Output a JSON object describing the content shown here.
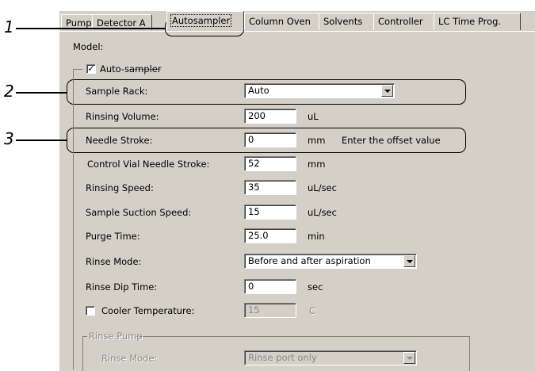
{
  "tabs": [
    "Pump",
    "Detector A",
    "Autosampler",
    "Column Oven",
    "Solvents",
    "Controller",
    "LC Time Prog."
  ],
  "active_tab": "Autosampler",
  "model_label": "Model:",
  "autosampler_checkbox": {
    "label": "Auto-sampler",
    "checked": "✓"
  },
  "callouts": [
    "1",
    "2",
    "3"
  ],
  "sample_rack": {
    "label": "Sample Rack:",
    "value": "Auto"
  },
  "rinsing_volume": {
    "label": "Rinsing Volume:",
    "value": "200",
    "unit": "uL"
  },
  "needle_stroke": {
    "label": "Needle Stroke:",
    "value": "0",
    "unit": "mm",
    "hint": "Enter the offset value"
  },
  "control_vial": {
    "label": "Control Vial Needle Stroke:",
    "value": "52",
    "unit": "mm"
  },
  "rinsing_speed": {
    "label": "Rinsing Speed:",
    "value": "35",
    "unit": "uL/sec"
  },
  "suction_speed": {
    "label": "Sample Suction Speed:",
    "value": "15",
    "unit": "uL/sec"
  },
  "purge_time": {
    "label": "Purge Time:",
    "value": "25.0",
    "unit": "min"
  },
  "rinse_mode": {
    "label": "Rinse Mode:",
    "value": "Before and after aspiration"
  },
  "rinse_dip_time": {
    "label": "Rinse Dip Time:",
    "value": "0",
    "unit": "sec"
  },
  "cooler": {
    "label": "Cooler Temperature:",
    "value": "15",
    "unit": "C"
  },
  "rinse_pump": {
    "title": "Rinse Pump",
    "mode_label": "Rinse Mode:",
    "mode_value": "Rinse port only"
  }
}
